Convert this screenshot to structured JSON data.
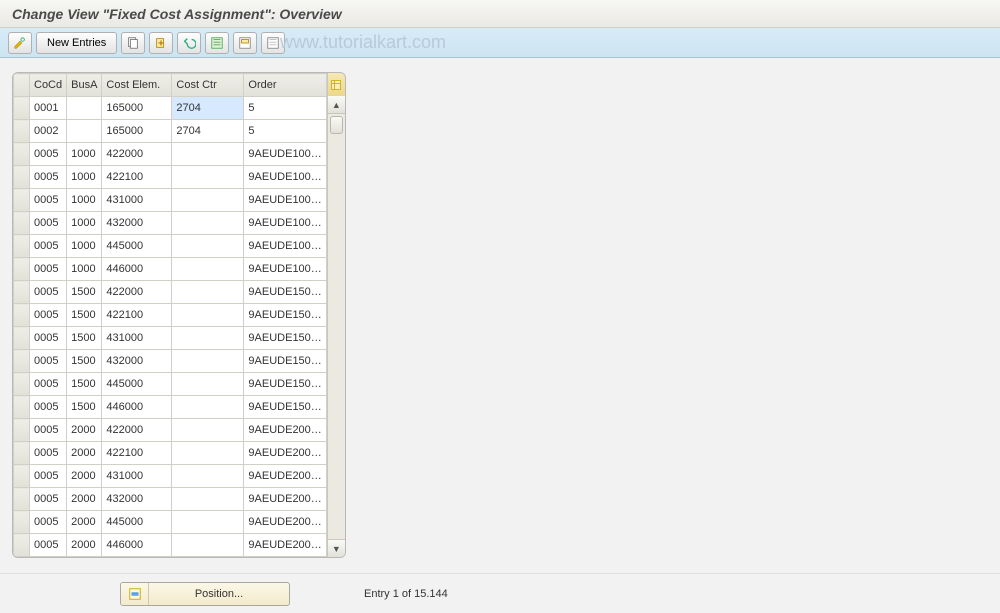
{
  "title": "Change View \"Fixed Cost Assignment\": Overview",
  "watermark": "www.tutorialkart.com",
  "toolbar": {
    "new_entries_label": "New Entries"
  },
  "columns": {
    "cocd": "CoCd",
    "busa": "BusA",
    "cost_elem": "Cost Elem.",
    "cost_ctr": "Cost Ctr",
    "order": "Order"
  },
  "rows": [
    {
      "cocd": "0001",
      "busa": "",
      "elem": "165000",
      "cctr": "2704",
      "order": "5",
      "highlight": true
    },
    {
      "cocd": "0002",
      "busa": "",
      "elem": "165000",
      "cctr": "2704",
      "order": "5"
    },
    {
      "cocd": "0005",
      "busa": "1000",
      "elem": "422000",
      "cctr": "",
      "order": "9AEUDE100…"
    },
    {
      "cocd": "0005",
      "busa": "1000",
      "elem": "422100",
      "cctr": "",
      "order": "9AEUDE100…"
    },
    {
      "cocd": "0005",
      "busa": "1000",
      "elem": "431000",
      "cctr": "",
      "order": "9AEUDE100…"
    },
    {
      "cocd": "0005",
      "busa": "1000",
      "elem": "432000",
      "cctr": "",
      "order": "9AEUDE100…"
    },
    {
      "cocd": "0005",
      "busa": "1000",
      "elem": "445000",
      "cctr": "",
      "order": "9AEUDE100…"
    },
    {
      "cocd": "0005",
      "busa": "1000",
      "elem": "446000",
      "cctr": "",
      "order": "9AEUDE100…"
    },
    {
      "cocd": "0005",
      "busa": "1500",
      "elem": "422000",
      "cctr": "",
      "order": "9AEUDE150…"
    },
    {
      "cocd": "0005",
      "busa": "1500",
      "elem": "422100",
      "cctr": "",
      "order": "9AEUDE150…"
    },
    {
      "cocd": "0005",
      "busa": "1500",
      "elem": "431000",
      "cctr": "",
      "order": "9AEUDE150…"
    },
    {
      "cocd": "0005",
      "busa": "1500",
      "elem": "432000",
      "cctr": "",
      "order": "9AEUDE150…"
    },
    {
      "cocd": "0005",
      "busa": "1500",
      "elem": "445000",
      "cctr": "",
      "order": "9AEUDE150…"
    },
    {
      "cocd": "0005",
      "busa": "1500",
      "elem": "446000",
      "cctr": "",
      "order": "9AEUDE150…"
    },
    {
      "cocd": "0005",
      "busa": "2000",
      "elem": "422000",
      "cctr": "",
      "order": "9AEUDE200…"
    },
    {
      "cocd": "0005",
      "busa": "2000",
      "elem": "422100",
      "cctr": "",
      "order": "9AEUDE200…"
    },
    {
      "cocd": "0005",
      "busa": "2000",
      "elem": "431000",
      "cctr": "",
      "order": "9AEUDE200…"
    },
    {
      "cocd": "0005",
      "busa": "2000",
      "elem": "432000",
      "cctr": "",
      "order": "9AEUDE200…"
    },
    {
      "cocd": "0005",
      "busa": "2000",
      "elem": "445000",
      "cctr": "",
      "order": "9AEUDE200…"
    },
    {
      "cocd": "0005",
      "busa": "2000",
      "elem": "446000",
      "cctr": "",
      "order": "9AEUDE200…"
    }
  ],
  "footer": {
    "position_label": "Position...",
    "entry_status": "Entry 1 of 15.144"
  }
}
